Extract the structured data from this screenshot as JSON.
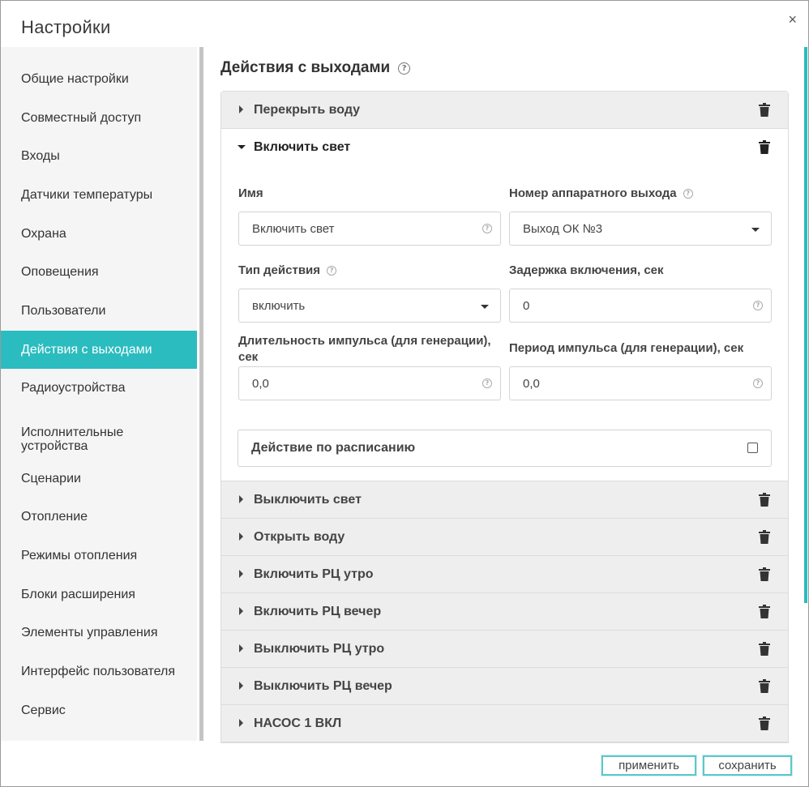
{
  "dialog": {
    "title": "Настройки",
    "close_glyph": "×"
  },
  "sidebar": {
    "active_index": 7,
    "items": [
      {
        "label": "Общие настройки"
      },
      {
        "label": "Совместный доступ"
      },
      {
        "label": "Входы"
      },
      {
        "label": "Датчики температуры"
      },
      {
        "label": "Охрана"
      },
      {
        "label": "Оповещения"
      },
      {
        "label": "Пользователи"
      },
      {
        "label": "Действия с выходами"
      },
      {
        "label": "Радиоустройства"
      },
      {
        "label": "Исполнительные устройства"
      },
      {
        "label": "Сценарии"
      },
      {
        "label": "Отопление"
      },
      {
        "label": "Режимы отопления"
      },
      {
        "label": "Блоки расширения"
      },
      {
        "label": "Элементы управления"
      },
      {
        "label": "Интерфейс пользователя"
      },
      {
        "label": "Сервис"
      }
    ]
  },
  "main": {
    "title": "Действия с выходами",
    "help_glyph": "?",
    "actions": [
      {
        "label": "Перекрыть воду",
        "expanded": false
      },
      {
        "label": "Включить свет",
        "expanded": true
      },
      {
        "label": "Выключить свет",
        "expanded": false
      },
      {
        "label": "Открыть воду",
        "expanded": false
      },
      {
        "label": "Включить РЦ утро",
        "expanded": false
      },
      {
        "label": "Включить РЦ вечер",
        "expanded": false
      },
      {
        "label": "Выключить РЦ утро",
        "expanded": false
      },
      {
        "label": "Выключить РЦ вечер",
        "expanded": false
      },
      {
        "label": "НАСОС 1 ВКЛ",
        "expanded": false
      }
    ],
    "form": {
      "name_label": "Имя",
      "name_value": "Включить свет",
      "output_label": "Номер аппаратного выхода",
      "output_value": "Выход ОК №3",
      "action_type_label": "Тип действия",
      "action_type_value": "включить",
      "delay_label": "Задержка включения, сек",
      "delay_value": "0",
      "pulse_duration_label_line1": "Длительность импульса (для генерации),",
      "pulse_duration_label_line2": "сек",
      "pulse_duration_value": "0,0",
      "pulse_period_label": "Период импульса (для генерации), сек",
      "pulse_period_value": "0,0",
      "schedule_label": "Действие по расписанию",
      "schedule_checked": false
    }
  },
  "footer": {
    "apply_label": "применить",
    "save_label": "сохранить"
  },
  "colors": {
    "accent": "#2bbcbf",
    "sidebar_bg": "#f5f5f5",
    "collapsed_header_bg": "#eeeeee"
  },
  "icons": {
    "help": "question-circle-icon",
    "delete": "trash-icon",
    "collapsed": "caret-right-icon",
    "expanded": "caret-down-icon",
    "dropdown": "caret-down-icon",
    "close": "close-icon"
  }
}
